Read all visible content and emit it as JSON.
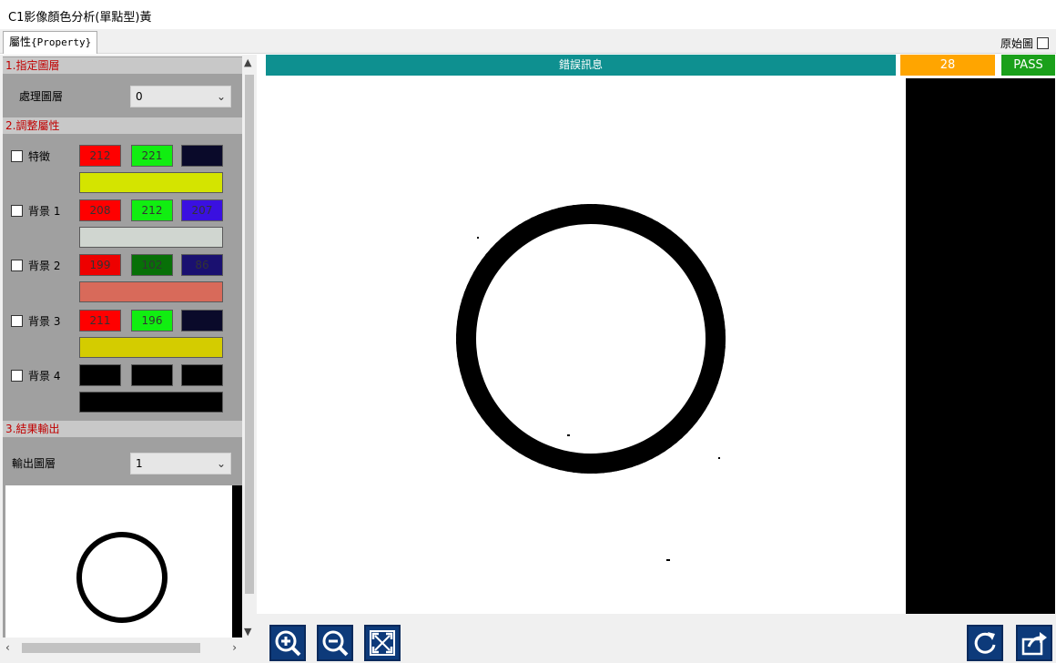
{
  "window": {
    "title": "C1影像顏色分析(單點型)黃"
  },
  "tab": {
    "label": "屬性",
    "sub": "{Property}"
  },
  "original_image_toggle": {
    "label": "原始圖",
    "checked": false
  },
  "sections": {
    "s1": {
      "title": "1.指定圖層"
    },
    "s2": {
      "title": "2.調整屬性"
    },
    "s3": {
      "title": "3.結果輸出"
    }
  },
  "process_layer": {
    "label": "處理圖層",
    "value": "0"
  },
  "output_layer": {
    "label": "輸出圖層",
    "value": "1"
  },
  "rows": [
    {
      "label": "特徵",
      "checked": false,
      "r": "212",
      "g": "221",
      "b": "",
      "r_color": "#ff0000",
      "g_color": "#11ee11",
      "b_color": "#0a0a2a",
      "bar_color": "#d4e400"
    },
    {
      "label": "背景 1",
      "checked": false,
      "r": "208",
      "g": "212",
      "b": "207",
      "r_color": "#ff0000",
      "g_color": "#11ee11",
      "b_color": "#3a10e0",
      "bar_color": "#d0d6d0"
    },
    {
      "label": "背景 2",
      "checked": false,
      "r": "199",
      "g": "102",
      "b": "86",
      "r_color": "#ee0000",
      "g_color": "#087008",
      "b_color": "#1a1070",
      "bar_color": "#d86a5a"
    },
    {
      "label": "背景 3",
      "checked": false,
      "r": "211",
      "g": "196",
      "b": "",
      "r_color": "#ff0000",
      "g_color": "#11ee11",
      "b_color": "#0a0a2a",
      "bar_color": "#d4cc00"
    },
    {
      "label": "背景 4",
      "checked": false,
      "r": "",
      "g": "",
      "b": "",
      "r_color": "#000000",
      "g_color": "#000000",
      "b_color": "#000000",
      "bar_color": "#000000"
    }
  ],
  "status": {
    "message": "錯誤訊息",
    "count": "28",
    "result": "PASS"
  },
  "colors": {
    "teal": "#0e9090",
    "orange": "#ffa500",
    "pass_green": "#1aa01a",
    "section_red": "#c00000",
    "button_blue": "#0d3a7a"
  },
  "toolbar": {
    "icons": [
      "zoom-in-icon",
      "zoom-out-icon",
      "fit-screen-icon",
      "reset-icon",
      "export-icon"
    ]
  }
}
